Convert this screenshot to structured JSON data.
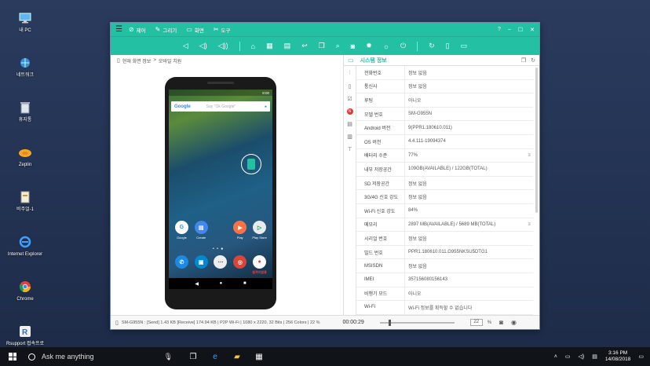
{
  "desktop": {
    "icons": [
      {
        "label": "내 PC",
        "icon": "pc-icon"
      },
      {
        "label": "네트워크",
        "icon": "network-icon"
      },
      {
        "label": "휴지통",
        "icon": "recycle-bin-icon"
      },
      {
        "label": "Zeplin",
        "icon": "zeplin-icon"
      },
      {
        "label": "비주얼-1",
        "icon": "document-icon"
      },
      {
        "label": "Internet Explorer",
        "icon": "ie-icon"
      },
      {
        "label": "Chrome",
        "icon": "chrome-icon"
      },
      {
        "label": "Rsupport 접속프로그램",
        "icon": "rsupport-icon"
      }
    ]
  },
  "window": {
    "menus": [
      "제어",
      "그리기",
      "화면",
      "도구"
    ],
    "controls": [
      "?",
      "–",
      "☐",
      "✕"
    ]
  },
  "breadcrumb": {
    "current": "현재 화면 정보",
    "separator": ">",
    "next": "모바일 치원"
  },
  "phone": {
    "status_time": "8:00",
    "search_logo": "Google",
    "search_placeholder": "Say \"Ok Google\"",
    "apps_row1": [
      {
        "label": "Google",
        "color": "#ffffff",
        "glyph": "G"
      },
      {
        "label": "Create",
        "color": "#4285f4",
        "glyph": "▤"
      },
      {
        "label": "Play",
        "color": "#ff7043",
        "glyph": "▶"
      },
      {
        "label": "Play Store",
        "color": "#e8eaed",
        "glyph": "▷"
      }
    ],
    "apps_row2": [
      {
        "label": "",
        "color": "#1e88e5",
        "glyph": "✆"
      },
      {
        "label": "",
        "color": "#0288d1",
        "glyph": "▣"
      },
      {
        "label": "",
        "color": "#eeeeee",
        "glyph": "⋯"
      },
      {
        "label": "",
        "color": "#ffffff",
        "glyph": "◎"
      },
      {
        "label": "원격지원용",
        "color": "#ffffff",
        "glyph": "●",
        "label_red": true
      }
    ]
  },
  "system_info": {
    "title": "시스템 정보",
    "rows": [
      {
        "key": "전화번호",
        "value": "정보 없음"
      },
      {
        "key": "통신사",
        "value": "정보 없음"
      },
      {
        "key": "루팅",
        "value": "아니오"
      },
      {
        "key": "모델 번호",
        "value": "SM-G955N"
      },
      {
        "key": "Android 버전",
        "value": "9(PPR1.180610.011)"
      },
      {
        "key": "OS 버전",
        "value": "4.4.111-19094374"
      },
      {
        "key": "배터리 수준",
        "value": "77%",
        "more": true
      },
      {
        "key": "내부 저장공간",
        "value": "109GB(AVAILABLE) / 122GB(TOTAL)"
      },
      {
        "key": "SD 저장공간",
        "value": "정보 없음"
      },
      {
        "key": "3G/4G 신호 강도",
        "value": "정보 없음"
      },
      {
        "key": "Wi-Fi 신호 강도",
        "value": "84%"
      },
      {
        "key": "메모리",
        "value": "2897 MB(AVAILABLE) / 5689 MB(TOTAL)",
        "more": true
      },
      {
        "key": "시리얼 번호",
        "value": "정보 없음"
      },
      {
        "key": "빌드 번호",
        "value": "PPR1.180610.011.G955NKSU5DTG1"
      },
      {
        "key": "MSISDN",
        "value": "정보 없음"
      },
      {
        "key": "IMEI",
        "value": "357156080156143"
      },
      {
        "key": "비행기 모드",
        "value": "아니오"
      },
      {
        "key": "Wi-Fi",
        "value": "Wi-Fi 정보를 획득할 수 없습니다"
      }
    ]
  },
  "statusbar": {
    "info": "SM-G955N : [Send] 1.43 KB  [Receive] 174.94 KB | P2P Wi-Fi | 1080 x 2220, 32 Bits | 256 Colors | 22 %",
    "timer": "00:00:29",
    "zoom": "22",
    "zoom_unit": "%",
    "slider_position": 0.12
  },
  "taskbar": {
    "search_text": "Ask me anything",
    "time": "3:16 PM",
    "date": "14/08/2018"
  },
  "colors": {
    "accent": "#24c0a4",
    "desktop_bg": "#23355a",
    "taskbar_bg": "#101418"
  }
}
